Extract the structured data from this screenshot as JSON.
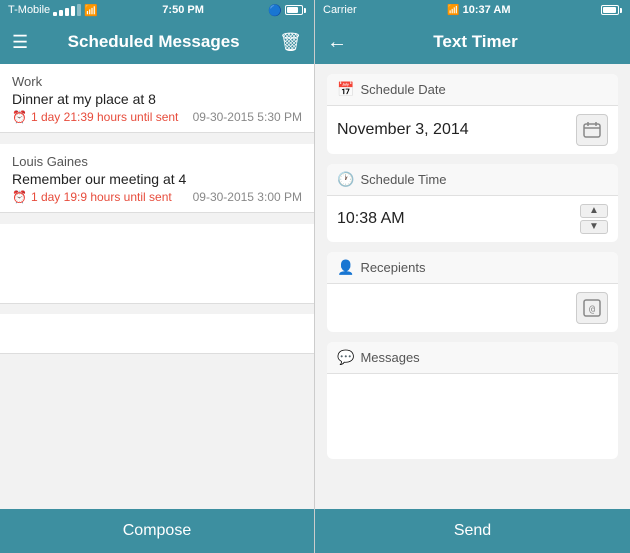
{
  "left": {
    "status_bar": {
      "carrier": "T-Mobile",
      "signal": "●●●●○",
      "time": "7:50 PM",
      "battery": "85"
    },
    "nav": {
      "title": "Scheduled Messages",
      "menu_label": "☰",
      "trash_label": "🗑"
    },
    "messages": [
      {
        "group": "Work",
        "text": "Dinner at my place at 8",
        "timer": "1 day 21:39 hours until sent",
        "date": "09-30-2015 5:30 PM"
      },
      {
        "group": "Louis Gaines",
        "text": "Remember our meeting at 4",
        "timer": "1 day 19:9 hours until sent",
        "date": "09-30-2015 3:00 PM"
      }
    ],
    "compose_label": "Compose"
  },
  "right": {
    "status_bar": {
      "carrier": "Carrier",
      "time": "10:37 AM",
      "battery": "100"
    },
    "nav": {
      "back_label": "←",
      "title": "Text Timer"
    },
    "form": {
      "schedule_date_label": "Schedule Date",
      "schedule_date_icon": "📅",
      "schedule_date_value": "November 3, 2014",
      "schedule_time_label": "Schedule Time",
      "schedule_time_icon": "🕐",
      "schedule_time_value": "10:38 AM",
      "recipients_label": "Recepients",
      "recipients_icon": "👤",
      "recipients_placeholder": "",
      "messages_label": "Messages",
      "messages_icon": "💬",
      "messages_placeholder": ""
    },
    "send_label": "Send"
  }
}
